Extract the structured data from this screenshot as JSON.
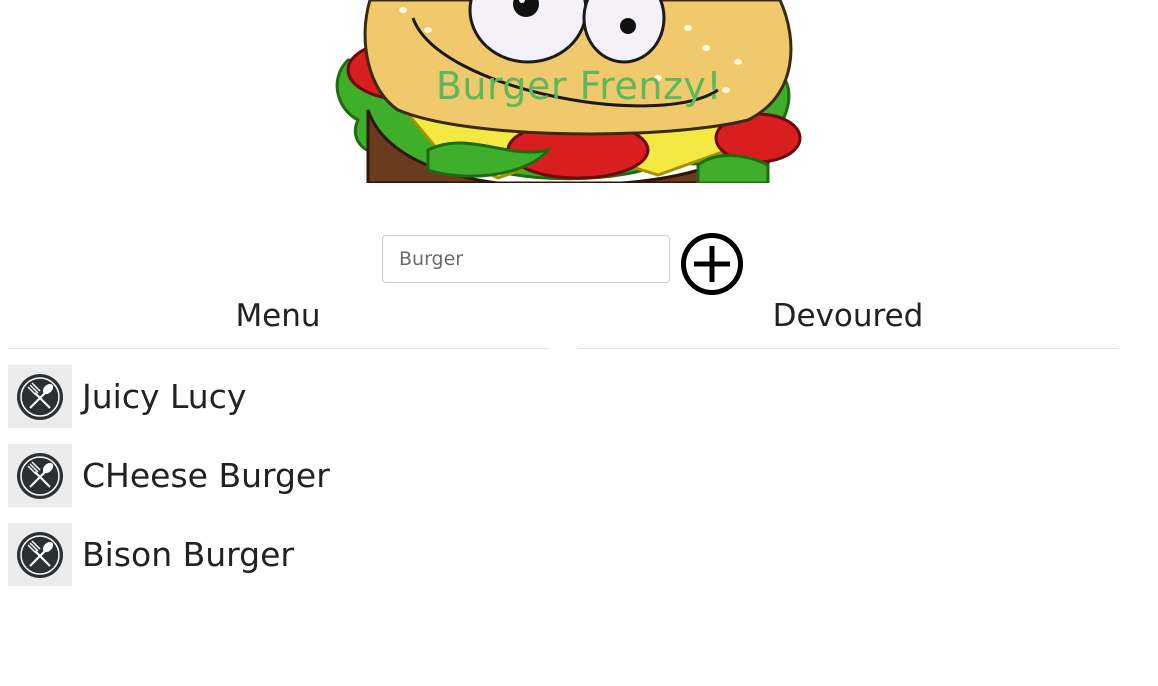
{
  "header": {
    "title": "Burger Frenzy!",
    "logo_icon": "cartoon-burger-icon",
    "title_color": "#5cb85c"
  },
  "add_form": {
    "placeholder": "Burger",
    "value": "",
    "add_icon": "plus-circle-icon"
  },
  "menu": {
    "title": "Menu",
    "items": [
      {
        "name": "Juicy Lucy",
        "icon": "fork-spoon-icon"
      },
      {
        "name": "CHeese Burger",
        "icon": "fork-spoon-icon"
      },
      {
        "name": "Bison Burger",
        "icon": "fork-spoon-icon"
      }
    ]
  },
  "devoured": {
    "title": "Devoured",
    "items": []
  }
}
